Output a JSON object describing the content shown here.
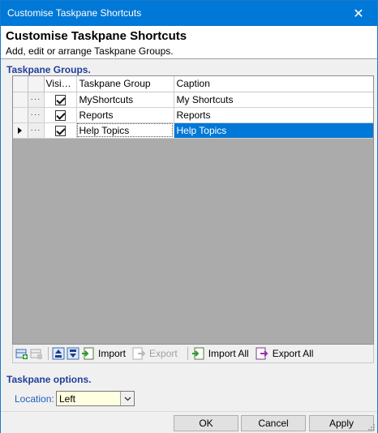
{
  "window": {
    "title": "Customise Taskpane Shortcuts",
    "close_glyph": "✕"
  },
  "header": {
    "title": "Customise Taskpane Shortcuts",
    "subtitle": "Add, edit or arrange Taskpane Groups."
  },
  "groups_section": {
    "label": "Taskpane Groups."
  },
  "grid": {
    "columns": {
      "visible": "Visible",
      "group": "Taskpane Group",
      "caption": "Caption"
    },
    "dots": "···",
    "rows": [
      {
        "visible": true,
        "group": "MyShortcuts",
        "caption": "My Shortcuts",
        "selected": false
      },
      {
        "visible": true,
        "group": "Reports",
        "caption": "Reports",
        "selected": false
      },
      {
        "visible": true,
        "group": "Help Topics",
        "caption": "Help Topics",
        "selected": true
      }
    ]
  },
  "toolbar": {
    "import_label": "Import",
    "export_label": "Export",
    "import_all_label": "Import All",
    "export_all_label": "Export All"
  },
  "options_section": {
    "label": "Taskpane options."
  },
  "location": {
    "label": "Location:",
    "value": "Left"
  },
  "buttons": {
    "ok": "OK",
    "cancel": "Cancel",
    "apply": "Apply"
  },
  "colors": {
    "accent": "#0078d7",
    "section": "#1f3f9a",
    "select_bg": "#ffffe1"
  }
}
